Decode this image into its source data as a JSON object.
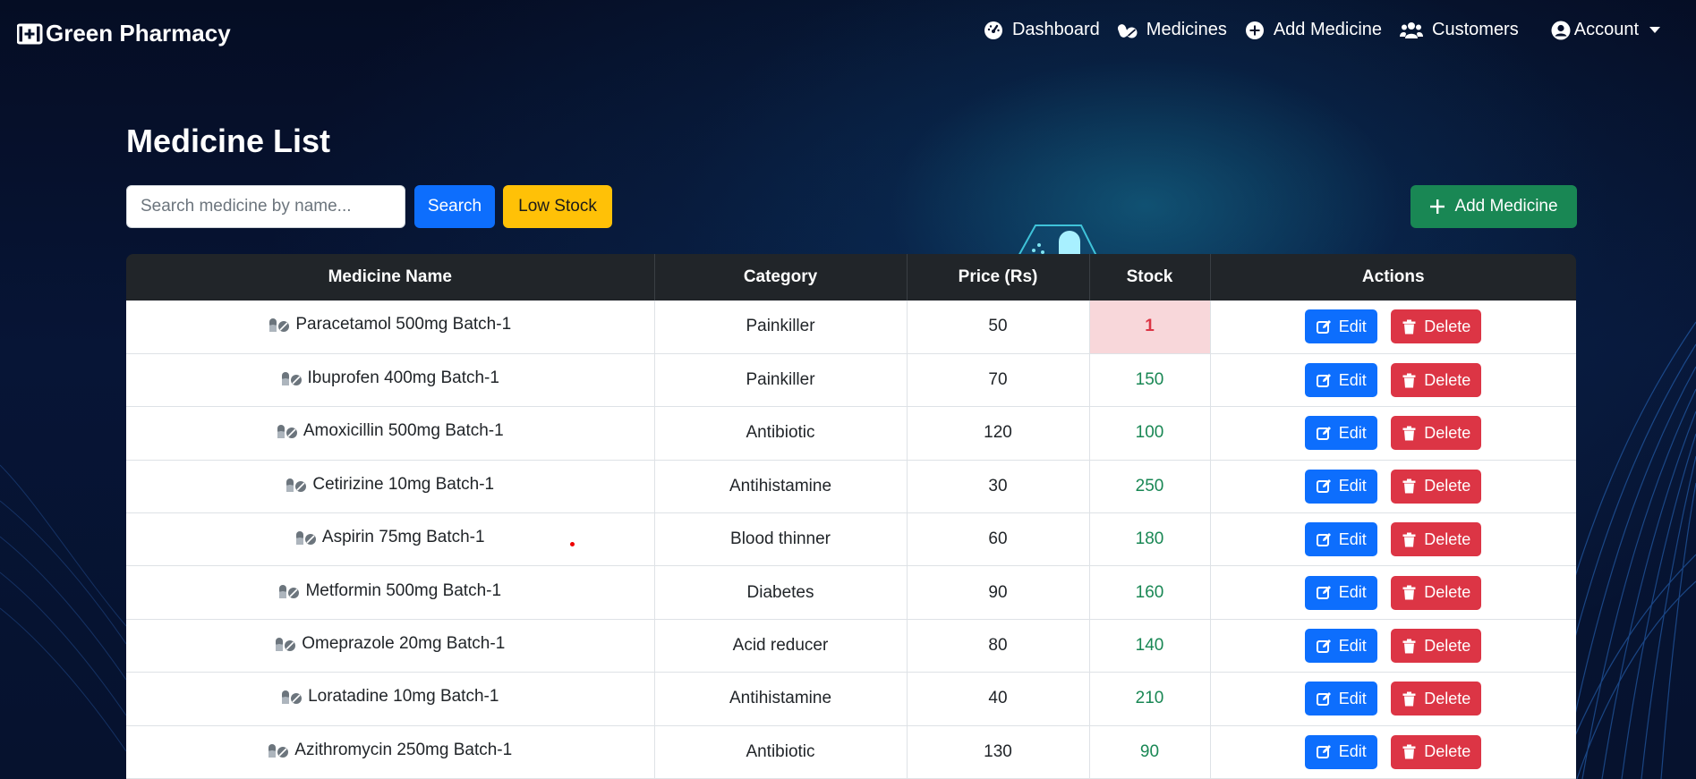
{
  "brand": {
    "name": "Green Pharmacy",
    "icon": "medical-kit-icon"
  },
  "nav": {
    "links": [
      {
        "label": "Dashboard",
        "icon": "speedometer-icon"
      },
      {
        "label": "Medicines",
        "icon": "capsules-icon"
      },
      {
        "label": "Add Medicine",
        "icon": "plus-circle-icon"
      },
      {
        "label": "Customers",
        "icon": "users-icon"
      }
    ],
    "account": {
      "label": "Account",
      "icon": "user-circle-icon"
    }
  },
  "page": {
    "title": "Medicine List",
    "search_placeholder": "Search medicine by name...",
    "search_label": "Search",
    "low_stock_label": "Low Stock",
    "add_label": "Add Medicine"
  },
  "table": {
    "headers": [
      "Medicine Name",
      "Category",
      "Price (Rs)",
      "Stock",
      "Actions"
    ],
    "edit_label": "Edit",
    "delete_label": "Delete",
    "rows": [
      {
        "name": "Paracetamol 500mg Batch-1",
        "category": "Painkiller",
        "price": "50",
        "stock": "1",
        "low": true
      },
      {
        "name": "Ibuprofen 400mg Batch-1",
        "category": "Painkiller",
        "price": "70",
        "stock": "150",
        "low": false
      },
      {
        "name": "Amoxicillin 500mg Batch-1",
        "category": "Antibiotic",
        "price": "120",
        "stock": "100",
        "low": false
      },
      {
        "name": "Cetirizine 10mg Batch-1",
        "category": "Antihistamine",
        "price": "30",
        "stock": "250",
        "low": false
      },
      {
        "name": "Aspirin 75mg Batch-1",
        "category": "Blood thinner",
        "price": "60",
        "stock": "180",
        "low": false
      },
      {
        "name": "Metformin 500mg Batch-1",
        "category": "Diabetes",
        "price": "90",
        "stock": "160",
        "low": false
      },
      {
        "name": "Omeprazole 20mg Batch-1",
        "category": "Acid reducer",
        "price": "80",
        "stock": "140",
        "low": false
      },
      {
        "name": "Loratadine 10mg Batch-1",
        "category": "Antihistamine",
        "price": "40",
        "stock": "210",
        "low": false
      },
      {
        "name": "Azithromycin 250mg Batch-1",
        "category": "Antibiotic",
        "price": "130",
        "stock": "90",
        "low": false
      }
    ]
  },
  "colors": {
    "primary": "#0d6efd",
    "warning": "#ffc107",
    "success": "#198754",
    "danger": "#dc3545",
    "header_dark": "#212529",
    "background": "#06102a"
  }
}
